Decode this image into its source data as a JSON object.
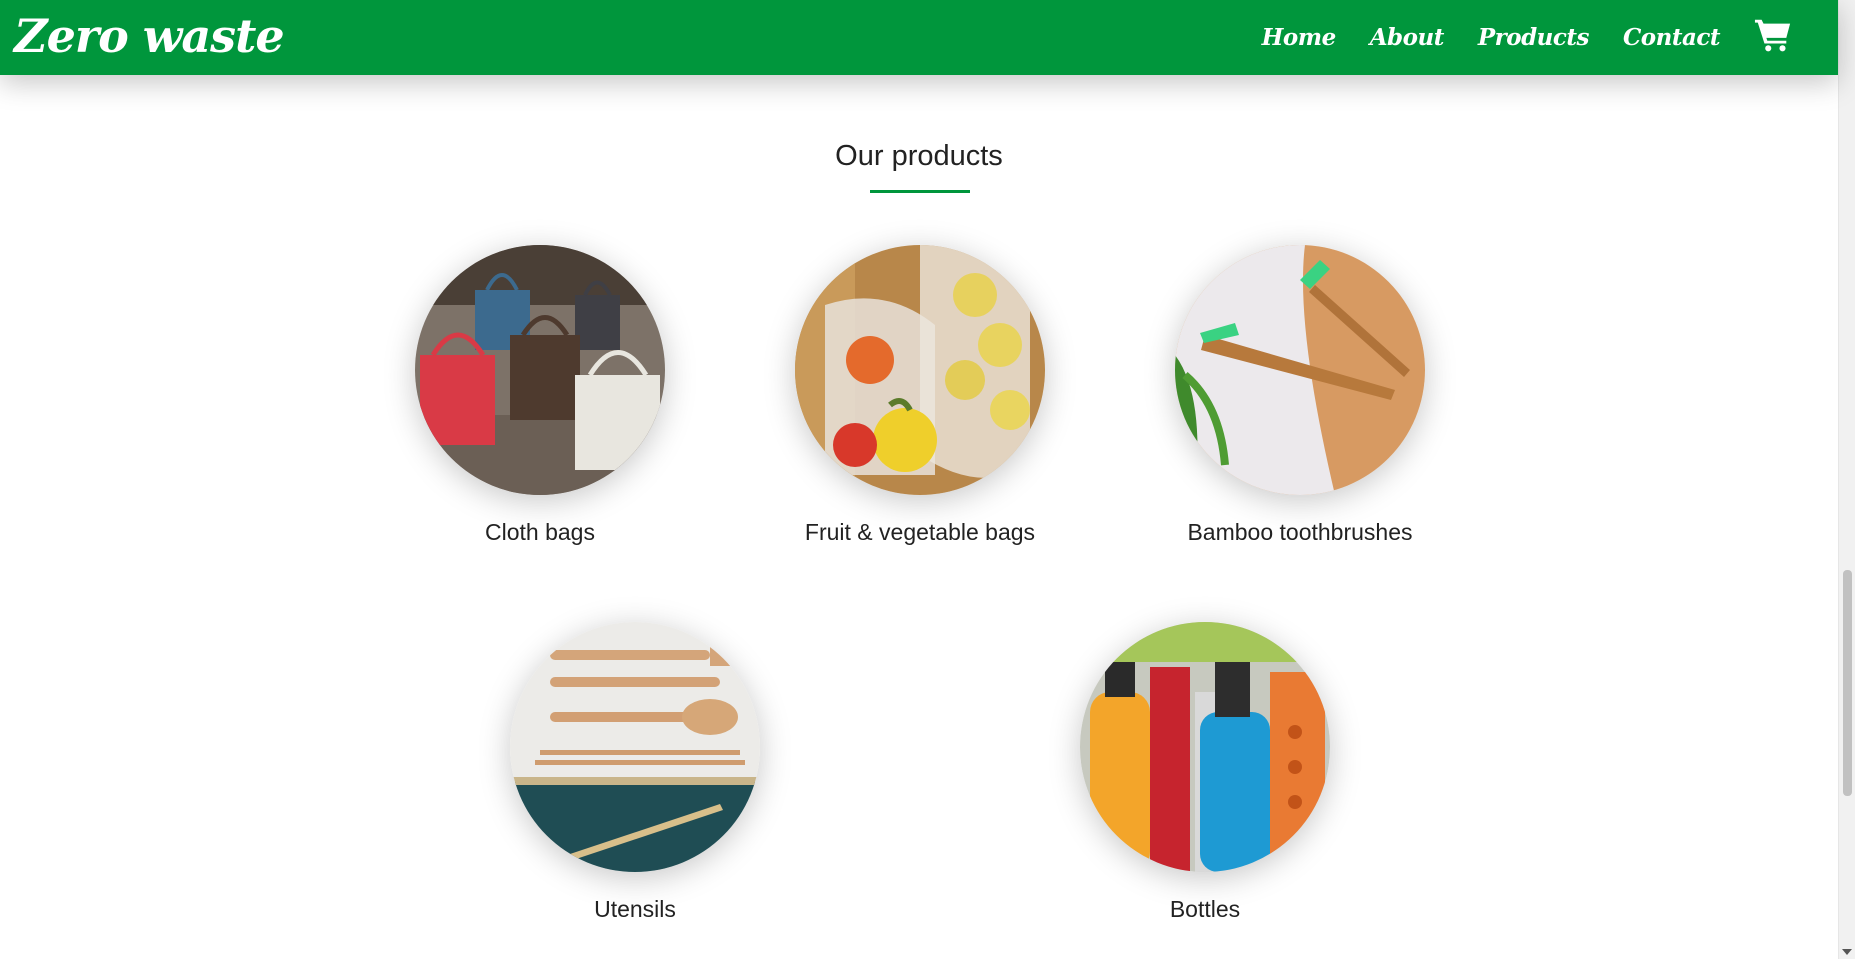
{
  "brand": {
    "name": "Zero waste"
  },
  "nav": {
    "items": [
      "Home",
      "About",
      "Products",
      "Contact"
    ],
    "cart_icon": "shopping-cart-icon"
  },
  "colors": {
    "brand_green": "#00963c",
    "text": "#222222",
    "background": "#ffffff"
  },
  "products_section": {
    "title": "Our products",
    "items": [
      {
        "label": "Cloth bags",
        "image": "cloth-bags-photo"
      },
      {
        "label": "Fruit & vegetable bags",
        "image": "produce-bags-photo"
      },
      {
        "label": "Bamboo toothbrushes",
        "image": "bamboo-toothbrush-photo"
      },
      {
        "label": "Utensils",
        "image": "bamboo-utensils-photo"
      },
      {
        "label": "Bottles",
        "image": "reusable-bottles-photo"
      }
    ]
  }
}
